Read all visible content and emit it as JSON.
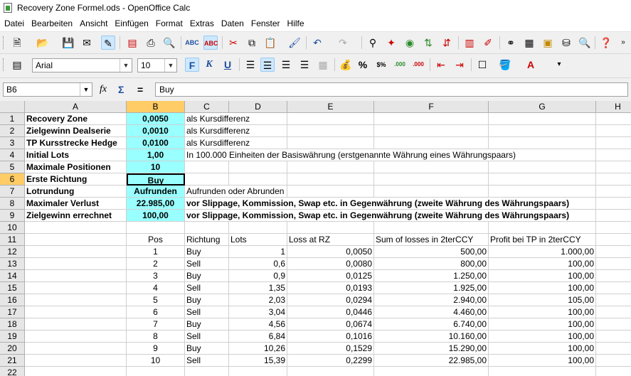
{
  "window": {
    "title": "Recovery Zone Formel.ods - OpenOffice Calc"
  },
  "menu": [
    "Datei",
    "Bearbeiten",
    "Ansicht",
    "Einfügen",
    "Format",
    "Extras",
    "Daten",
    "Fenster",
    "Hilfe"
  ],
  "format_toolbar": {
    "font_name": "Arial",
    "font_size": "10",
    "bold": "F",
    "italic": "K",
    "underline": "U",
    "percent": "%",
    "currency": "$%",
    "decimal_add": ".000",
    "decimal_del": ".000"
  },
  "formula_bar": {
    "cell_ref": "B6",
    "fx": "fx",
    "sum": "Σ",
    "equals": "=",
    "content": "Buy"
  },
  "columns": [
    "A",
    "B",
    "C",
    "D",
    "E",
    "F",
    "G",
    "H"
  ],
  "rows": [
    "1",
    "2",
    "3",
    "4",
    "5",
    "6",
    "7",
    "8",
    "9",
    "10",
    "11",
    "12",
    "13",
    "14",
    "15",
    "16",
    "17",
    "18",
    "19",
    "20",
    "21",
    "22"
  ],
  "params": [
    {
      "label": "Recovery Zone",
      "value": "0,0050",
      "note": "als Kursdifferenz"
    },
    {
      "label": "Zielgewinn Dealserie",
      "value": "0,0010",
      "note": "als Kursdifferenz"
    },
    {
      "label": "TP Kursstrecke Hedge",
      "value": "0,0100",
      "note": "als Kursdifferenz"
    },
    {
      "label": "Initial Lots",
      "value": "1,00",
      "note": "In 100.000 Einheiten der Basiswährung (erstgenannte Währung eines Währungspaars)"
    },
    {
      "label": "Maximale Positionen",
      "value": "10",
      "note": ""
    },
    {
      "label": "Erste Richtung",
      "value": "Buy",
      "note": ""
    },
    {
      "label": "Lotrundung",
      "value": "Aufrunden",
      "note": "Aufrunden oder Abrunden"
    },
    {
      "label": "Maximaler Verlust",
      "value": "22.985,00",
      "note": "vor Slippage, Kommission, Swap etc. in Gegenwährung (zweite Währung des Währungspaars)"
    },
    {
      "label": "Zielgewinn errechnet",
      "value": "100,00",
      "note": "vor Slippage, Kommission, Swap etc. in Gegenwährung (zweite Währung des Währungspaars)"
    }
  ],
  "table_headers": [
    "Pos",
    "Richtung",
    "Lots",
    "Loss at RZ",
    "Sum of losses in 2terCCY",
    "Profit bei TP in 2terCCY"
  ],
  "table_rows": [
    [
      "1",
      "Buy",
      "1",
      "0,0050",
      "500,00",
      "1.000,00"
    ],
    [
      "2",
      "Sell",
      "0,6",
      "0,0080",
      "800,00",
      "100,00"
    ],
    [
      "3",
      "Buy",
      "0,9",
      "0,0125",
      "1.250,00",
      "100,00"
    ],
    [
      "4",
      "Sell",
      "1,35",
      "0,0193",
      "1.925,00",
      "100,00"
    ],
    [
      "5",
      "Buy",
      "2,03",
      "0,0294",
      "2.940,00",
      "105,00"
    ],
    [
      "6",
      "Sell",
      "3,04",
      "0,0446",
      "4.460,00",
      "100,00"
    ],
    [
      "7",
      "Buy",
      "4,56",
      "0,0674",
      "6.740,00",
      "100,00"
    ],
    [
      "8",
      "Sell",
      "6,84",
      "0,1016",
      "10.160,00",
      "100,00"
    ],
    [
      "9",
      "Buy",
      "10,26",
      "0,1529",
      "15.290,00",
      "100,00"
    ],
    [
      "10",
      "Sell",
      "15,39",
      "0,2299",
      "22.985,00",
      "100,00"
    ]
  ]
}
